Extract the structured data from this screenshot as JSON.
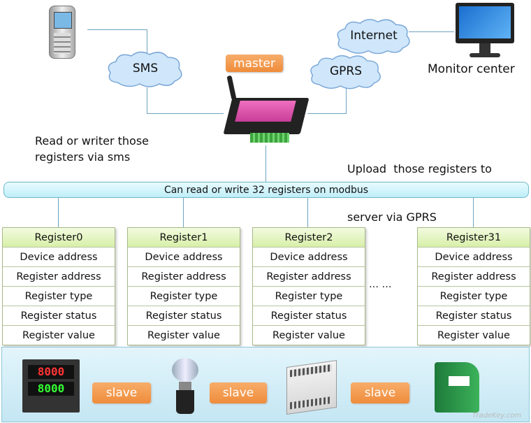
{
  "top": {
    "clouds": {
      "sms": "SMS",
      "gprs": "GPRS",
      "internet": "Internet"
    },
    "master_label": "master",
    "monitor_label": "Monitor center",
    "left_note": [
      "Read or writer those",
      "registers via sms"
    ],
    "right_note": [
      "Upload  those registers to",
      "server via GPRS"
    ],
    "icons": [
      "mobile-phone-icon",
      "gsm-rtu-device-icon",
      "monitor-icon"
    ]
  },
  "bus_label": "Can read or write 32 registers on modbus",
  "registers": [
    {
      "title": "Register0",
      "fields": [
        "Device address",
        "Register address",
        "Register type",
        "Register status",
        "Register value"
      ]
    },
    {
      "title": "Register1",
      "fields": [
        "Device address",
        "Register address",
        "Register type",
        "Register status",
        "Register value"
      ]
    },
    {
      "title": "Register2",
      "fields": [
        "Device address",
        "Register address",
        "Register type",
        "Register status",
        "Register value"
      ]
    },
    {
      "title": "Register31",
      "fields": [
        "Device address",
        "Register address",
        "Register type",
        "Register status",
        "Register value"
      ]
    }
  ],
  "ellipsis": "… …",
  "slaves": [
    "slave",
    "slave",
    "slave"
  ],
  "slave_icons": [
    "temperature-controller-icon",
    "level-sensor-icon",
    "plc-icon",
    "signal-module-icon"
  ],
  "watermark": "TradeKey.com",
  "colors": {
    "line": "#6fa3c0",
    "tag": "#ef8c3a",
    "cloud": "#cfe6fb",
    "register_header": "#d7efa8"
  }
}
